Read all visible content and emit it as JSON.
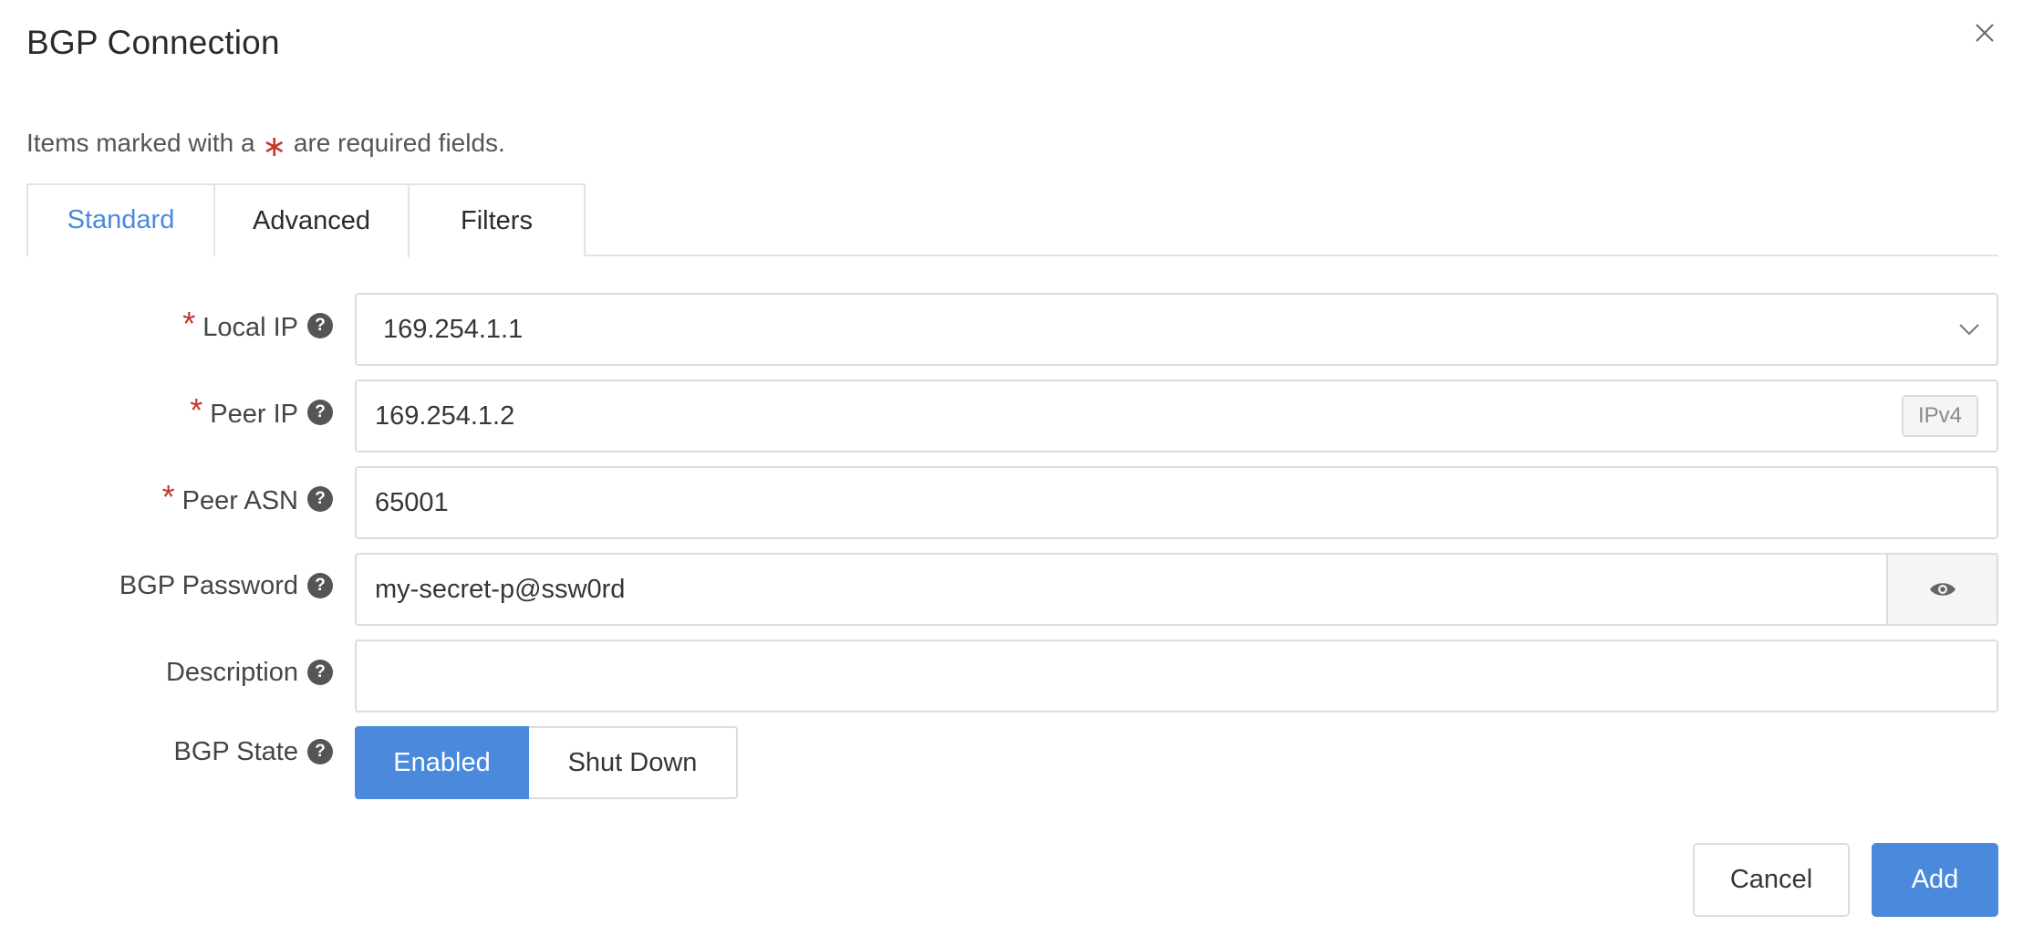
{
  "dialog": {
    "title": "BGP Connection",
    "required_note_prefix": "Items marked with a",
    "required_note_star": "∗",
    "required_note_suffix": "are required fields."
  },
  "tabs": [
    {
      "label": "Standard",
      "active": true
    },
    {
      "label": "Advanced",
      "active": false
    },
    {
      "label": "Filters",
      "active": false
    }
  ],
  "form": {
    "local_ip": {
      "label": "Local IP",
      "required": true,
      "value": "169.254.1.1"
    },
    "peer_ip": {
      "label": "Peer IP",
      "required": true,
      "value": "169.254.1.2",
      "badge": "IPv4"
    },
    "peer_asn": {
      "label": "Peer ASN",
      "required": true,
      "value": "65001"
    },
    "bgp_password": {
      "label": "BGP Password",
      "required": false,
      "value": "my-secret-p@ssw0rd"
    },
    "description": {
      "label": "Description",
      "required": false,
      "value": ""
    },
    "bgp_state": {
      "label": "BGP State",
      "options": [
        "Enabled",
        "Shut Down"
      ],
      "selected": "Enabled"
    }
  },
  "required_star": "*",
  "help_glyph": "?",
  "footer": {
    "cancel_label": "Cancel",
    "add_label": "Add"
  },
  "colors": {
    "accent": "#4a89dc",
    "required": "#c0392b"
  }
}
